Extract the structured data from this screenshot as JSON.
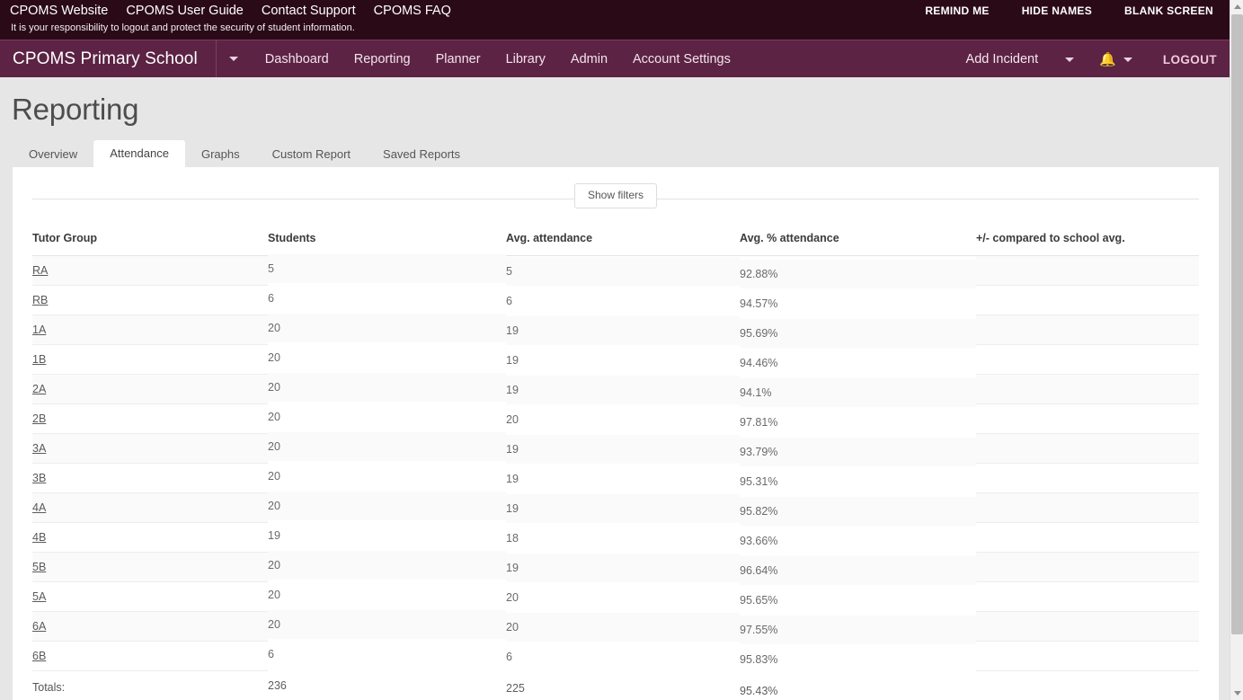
{
  "topbar": {
    "links": [
      {
        "label": "CPOMS Website"
      },
      {
        "label": "CPOMS User Guide"
      },
      {
        "label": "Contact Support"
      },
      {
        "label": "CPOMS FAQ"
      }
    ],
    "notice": "It is your responsibility to logout and protect the security of student information.",
    "actions": [
      {
        "label": "REMIND ME"
      },
      {
        "label": "HIDE NAMES"
      },
      {
        "label": "BLANK SCREEN"
      }
    ]
  },
  "navbar": {
    "brand": "CPOMS Primary School",
    "brand_caret_icon": "chevron-down-icon",
    "links": [
      {
        "label": "Dashboard"
      },
      {
        "label": "Reporting"
      },
      {
        "label": "Planner"
      },
      {
        "label": "Library"
      },
      {
        "label": "Admin"
      },
      {
        "label": "Account Settings"
      }
    ],
    "add_incident": "Add Incident",
    "add_incident_caret_icon": "chevron-down-icon",
    "bell_icon": "bell-icon",
    "bell_caret_icon": "chevron-down-icon",
    "logout": "LOGOUT",
    "accent_color": "#5c2344",
    "topbar_color": "#2b0a18"
  },
  "page": {
    "title": "Reporting"
  },
  "tabs": [
    {
      "label": "Overview",
      "active": false
    },
    {
      "label": "Attendance",
      "active": true
    },
    {
      "label": "Graphs",
      "active": false
    },
    {
      "label": "Custom Report",
      "active": false
    },
    {
      "label": "Saved Reports",
      "active": false
    }
  ],
  "filters": {
    "show_filters_label": "Show filters"
  },
  "table": {
    "columns": [
      "Tutor Group",
      "Students",
      "Avg. attendance",
      "Avg. % attendance",
      "+/- compared to school avg."
    ],
    "rows": [
      {
        "group": "RA",
        "students": "5",
        "avg": "5",
        "pct": "92.88%",
        "cmp": ""
      },
      {
        "group": "RB",
        "students": "6",
        "avg": "6",
        "pct": "94.57%",
        "cmp": ""
      },
      {
        "group": "1A",
        "students": "20",
        "avg": "19",
        "pct": "95.69%",
        "cmp": ""
      },
      {
        "group": "1B",
        "students": "20",
        "avg": "19",
        "pct": "94.46%",
        "cmp": ""
      },
      {
        "group": "2A",
        "students": "20",
        "avg": "19",
        "pct": "94.1%",
        "cmp": ""
      },
      {
        "group": "2B",
        "students": "20",
        "avg": "20",
        "pct": "97.81%",
        "cmp": ""
      },
      {
        "group": "3A",
        "students": "20",
        "avg": "19",
        "pct": "93.79%",
        "cmp": ""
      },
      {
        "group": "3B",
        "students": "20",
        "avg": "19",
        "pct": "95.31%",
        "cmp": ""
      },
      {
        "group": "4A",
        "students": "20",
        "avg": "19",
        "pct": "95.82%",
        "cmp": ""
      },
      {
        "group": "4B",
        "students": "19",
        "avg": "18",
        "pct": "93.66%",
        "cmp": ""
      },
      {
        "group": "5B",
        "students": "20",
        "avg": "19",
        "pct": "96.64%",
        "cmp": ""
      },
      {
        "group": "5A",
        "students": "20",
        "avg": "20",
        "pct": "95.65%",
        "cmp": ""
      },
      {
        "group": "6A",
        "students": "20",
        "avg": "20",
        "pct": "97.55%",
        "cmp": ""
      },
      {
        "group": "6B",
        "students": "6",
        "avg": "6",
        "pct": "95.83%",
        "cmp": ""
      }
    ],
    "totals": {
      "label": "Totals:",
      "students": "236",
      "avg": "225",
      "pct": "95.43%",
      "cmp": ""
    }
  }
}
